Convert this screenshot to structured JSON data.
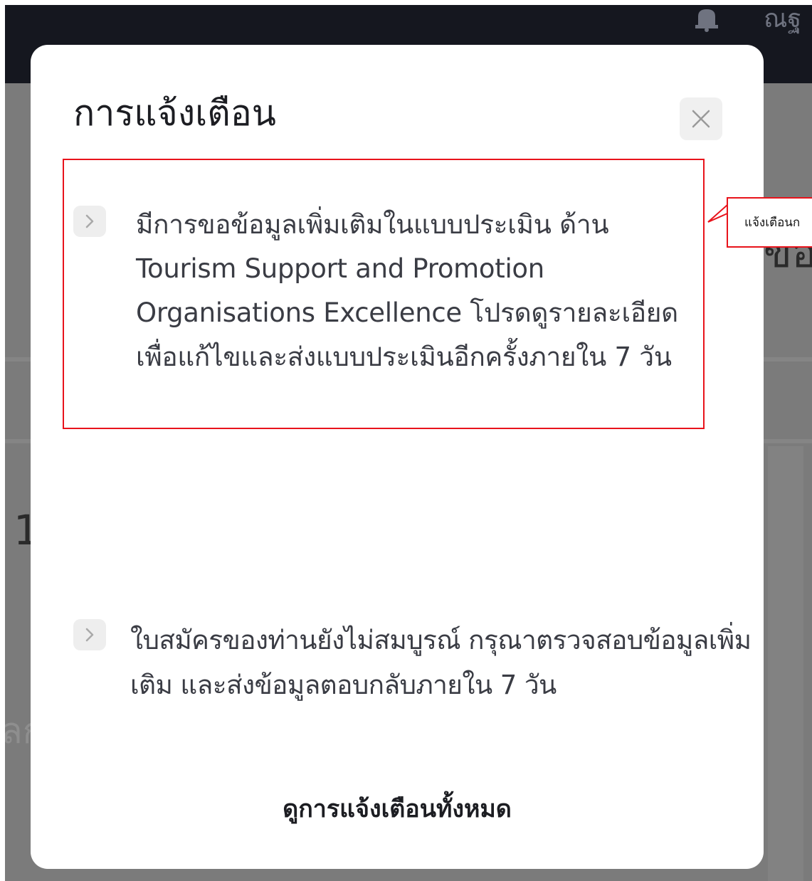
{
  "background": {
    "user_name_fragment": "ณฐ",
    "fragment_right": "ขอ",
    "fragment_left_1": "1",
    "fragment_left_2": "ลก"
  },
  "modal": {
    "title": "การแจ้งเตือน",
    "close_label": "×",
    "notifications": [
      {
        "text": "มีการขอข้อมูลเพิ่มเติมในแบบประเมิน ด้าน Tourism Support and Promotion  Organisations Excellence โปรดดูรายละเอียด เพื่อแก้ไขและส่งแบบประเมินอีกครั้งภายใน 7 วัน"
      },
      {
        "text": "ใบสมัครของท่านยังไม่สมบูรณ์ กรุณาตรวจสอบข้อมูลเพิ่มเติม และส่งข้อมูลตอบกลับภายใน 7 วัน"
      }
    ],
    "view_all_label": "ดูการแจ้งเตือนทั้งหมด"
  },
  "annotation": {
    "callout_text": "แจ้งเตือนก",
    "color": "#e8131b"
  },
  "icons": {
    "bell": "bell-icon",
    "close": "close-icon",
    "chevron": "chevron-right-icon"
  }
}
